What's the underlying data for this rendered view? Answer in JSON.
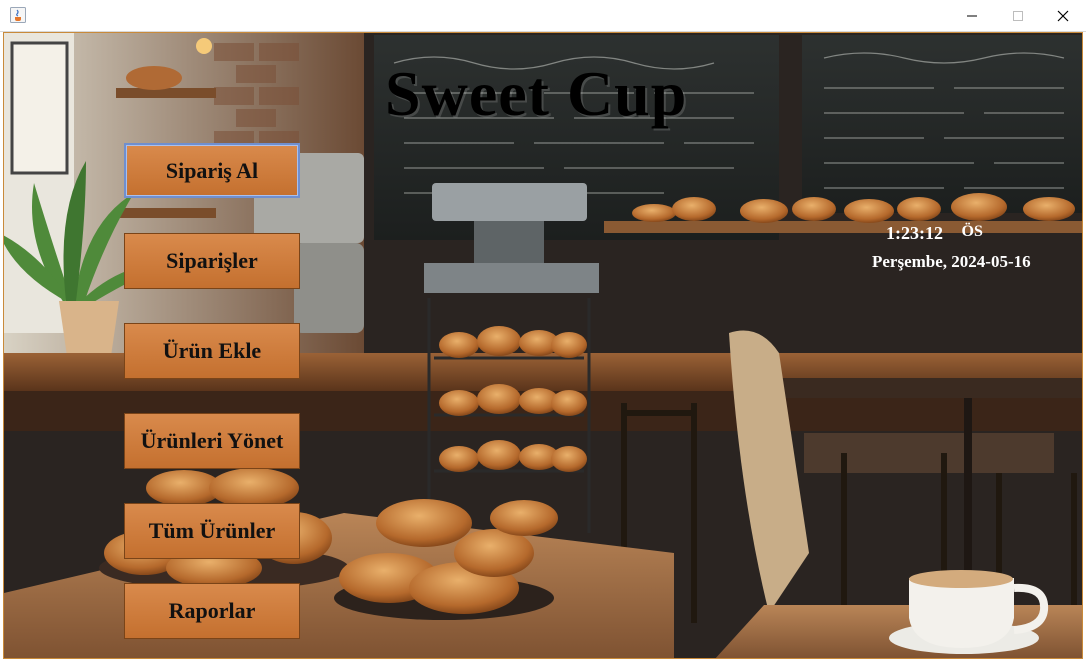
{
  "window": {
    "title": "",
    "controls": {
      "minimize_icon": "minimize-icon",
      "maximize_icon": "maximize-icon",
      "close_icon": "close-icon"
    }
  },
  "app": {
    "title": "Sweet Cup"
  },
  "clock": {
    "time": "1:23:12",
    "ampm": "ÖS",
    "date": "Perşembe, 2024-05-16"
  },
  "menu": {
    "take_order": "Sipariş Al",
    "orders": "Siparişler",
    "add_product": "Ürün Ekle",
    "manage_products": "Ürünleri Yönet",
    "all_products": "Tüm Ürünler",
    "reports": "Raporlar"
  },
  "colors": {
    "button_bg": "#c4702f",
    "button_border": "#7a4418",
    "focus_ring": "#6f8fcf",
    "title_text": "#000000",
    "clock_text": "#ffffff"
  }
}
